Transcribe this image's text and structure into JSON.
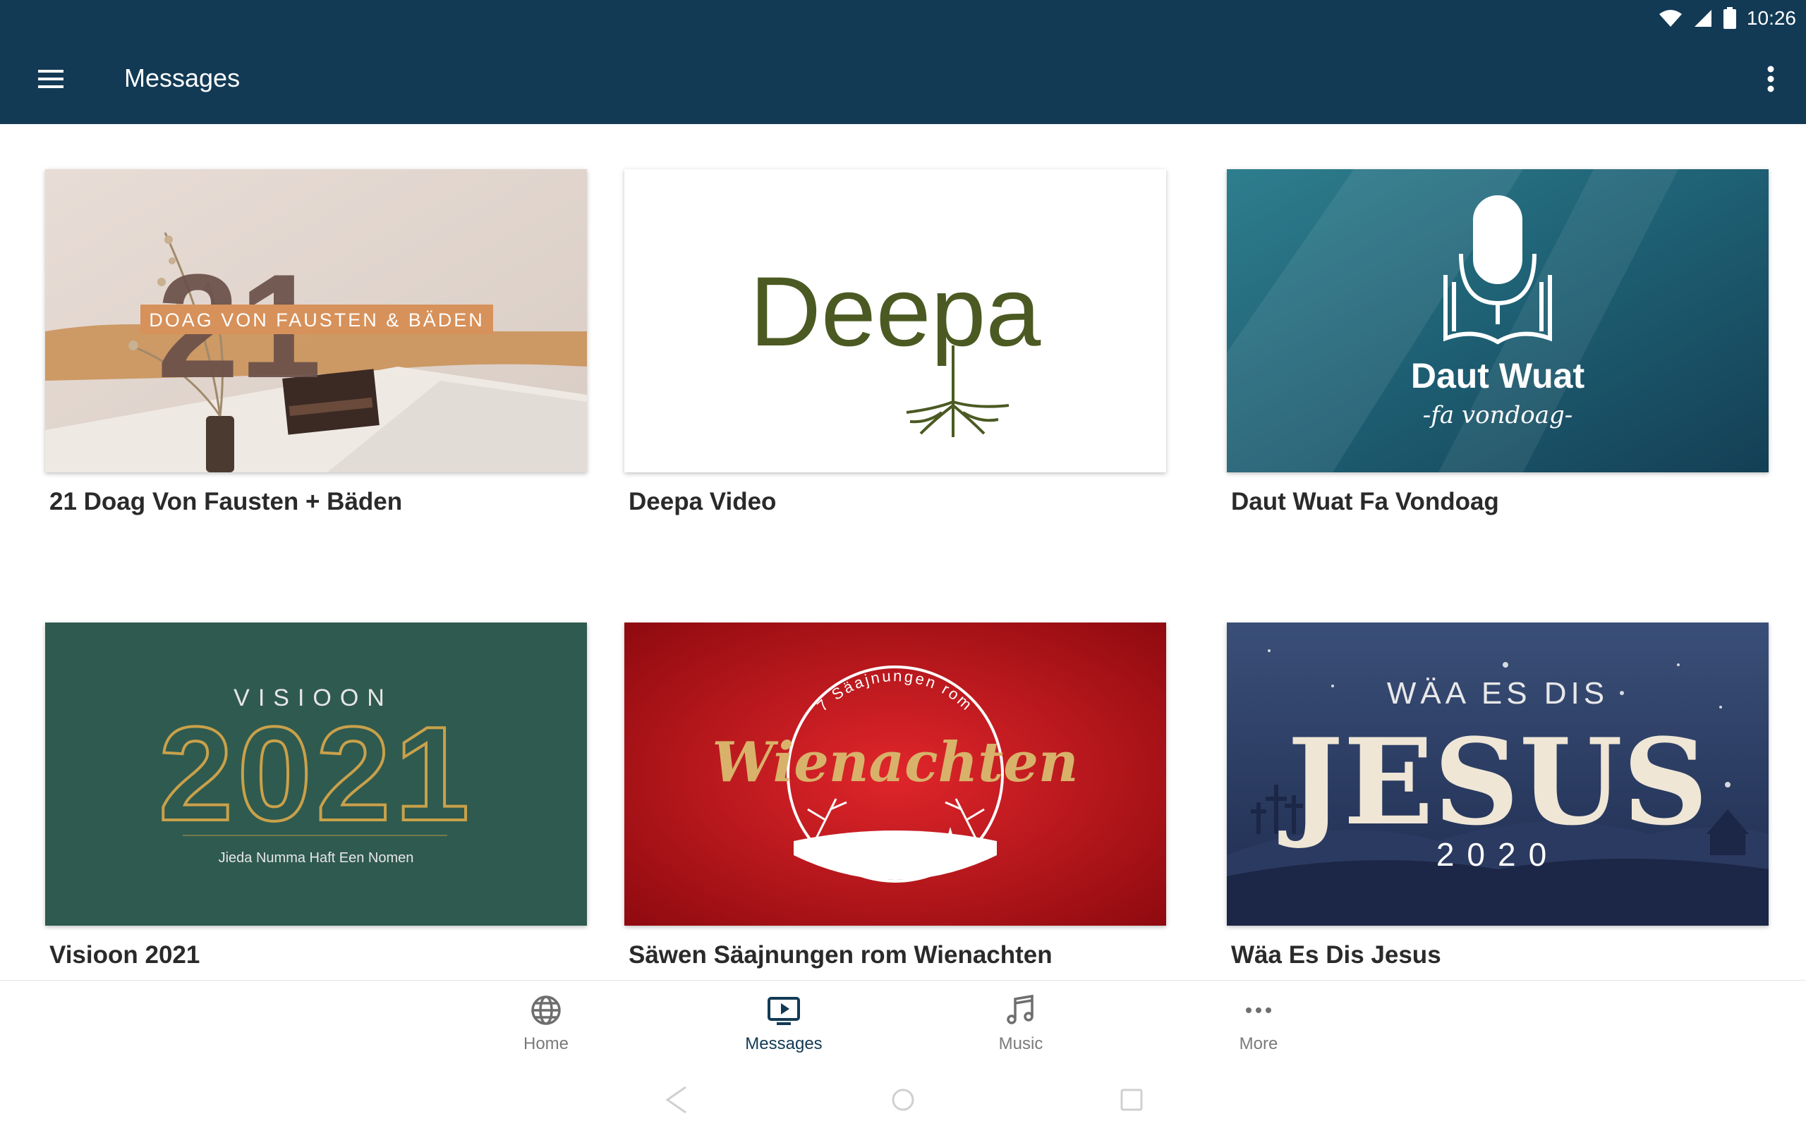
{
  "status_bar": {
    "time": "10:26"
  },
  "appbar": {
    "title": "Messages"
  },
  "cards": [
    {
      "title": "21 Doag Von Fausten + Bäden",
      "art": {
        "big_number": "21",
        "banner": "DOAG VON FAUSTEN & BÄDEN"
      }
    },
    {
      "title": "Deepa Video",
      "art": {
        "wordmark": "Deepa"
      }
    },
    {
      "title": "Daut Wuat Fa Vondoag",
      "art": {
        "line1": "Daut Wuat",
        "line2": "-fa vondoag-"
      }
    },
    {
      "title": "Visioon 2021",
      "art": {
        "heading": "VISIOON",
        "year": "2021",
        "tagline": "Jieda Numma Haft Een Nomen"
      }
    },
    {
      "title": "Säwen Säajnungen rom Wienachten",
      "art": {
        "arc": "7 Säajnungen rom",
        "script": "Wienachten"
      }
    },
    {
      "title": "Wäa Es Dis Jesus",
      "art": {
        "top": "WÄA ES DIS",
        "main": "JESUS",
        "year": "2020"
      }
    }
  ],
  "bottom_nav": [
    {
      "label": "Home",
      "icon": "globe-icon",
      "active": false
    },
    {
      "label": "Messages",
      "icon": "tv-play-icon",
      "active": true
    },
    {
      "label": "Music",
      "icon": "music-note-icon",
      "active": false
    },
    {
      "label": "More",
      "icon": "more-horizontal-icon",
      "active": false
    }
  ],
  "colors": {
    "appbar": "#123a55",
    "active_nav": "#123a55",
    "inactive_nav": "#7a7a7a"
  }
}
